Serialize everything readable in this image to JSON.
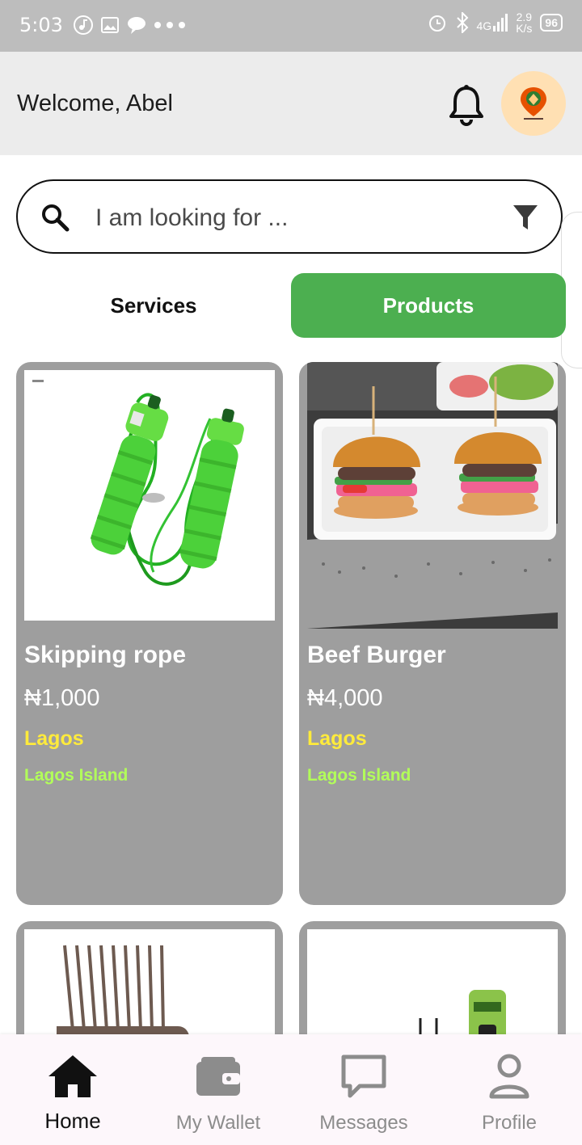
{
  "status_bar": {
    "time": "5:03",
    "network": "4G",
    "speed_value": "2.9",
    "speed_unit": "K/s",
    "battery": "96"
  },
  "header": {
    "welcome": "Welcome, Abel"
  },
  "search": {
    "placeholder": "I am looking for ..."
  },
  "tabs": [
    {
      "label": "Services",
      "active": false
    },
    {
      "label": "Products",
      "active": true
    }
  ],
  "products": [
    {
      "name": "Skipping rope",
      "price": "₦1,000",
      "state": "Lagos",
      "area": "Lagos Island"
    },
    {
      "name": "Beef Burger",
      "price": "₦4,000",
      "state": "Lagos",
      "area": "Lagos Island"
    }
  ],
  "bottom_nav": [
    {
      "label": "Home",
      "icon": "home-icon",
      "active": true
    },
    {
      "label": "My Wallet",
      "icon": "wallet-icon",
      "active": false
    },
    {
      "label": "Messages",
      "icon": "message-icon",
      "active": false
    },
    {
      "label": "Profile",
      "icon": "person-icon",
      "active": false
    }
  ],
  "colors": {
    "accent_green": "#4caf50",
    "card_gray": "#9e9e9e",
    "state_yellow": "#ffeb3b",
    "area_green": "#b2ff59",
    "header_bg": "#ececec",
    "status_bg": "#bdbdbd"
  }
}
